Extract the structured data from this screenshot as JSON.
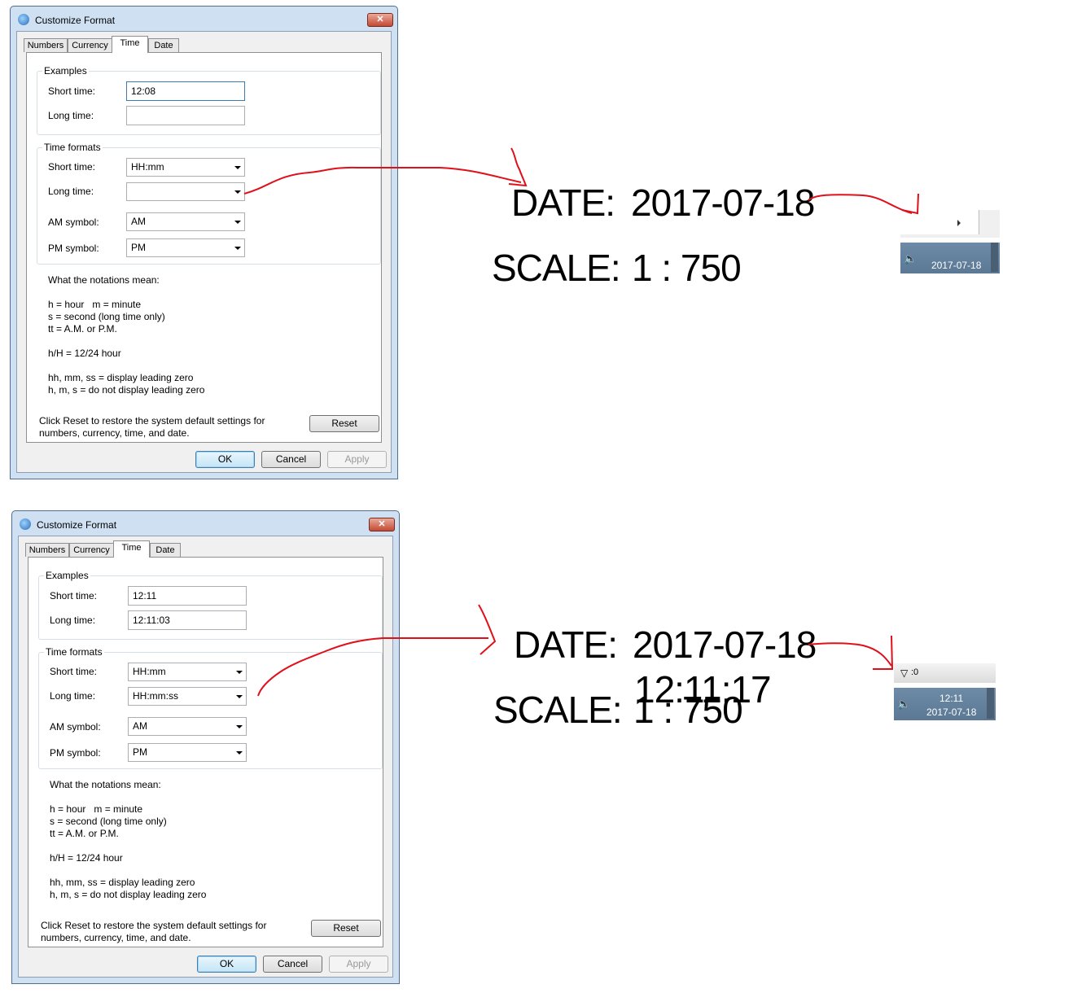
{
  "dialog": {
    "title": "Customize Format",
    "close_glyph": "✕",
    "tabs": [
      "Numbers",
      "Currency",
      "Time",
      "Date"
    ],
    "examples_heading": "Examples",
    "short_time_label": "Short time:",
    "long_time_label": "Long time:",
    "formats_heading": "Time formats",
    "am_label": "AM symbol:",
    "pm_label": "PM symbol:",
    "notations_heading": "What the notations mean:",
    "notation_line1": "h = hour   m = minute",
    "notation_line2": "s = second (long time only)",
    "notation_line3": "tt = A.M. or P.M.",
    "notation_line4": "h/H = 12/24 hour",
    "notation_line5": "hh, mm, ss = display leading zero",
    "notation_line6": "h, m, s = do not display leading zero",
    "reset_text_line1": "Click Reset to restore the system default settings for",
    "reset_text_line2": "numbers, currency, time, and date.",
    "reset_button": "Reset",
    "ok_button": "OK",
    "cancel_button": "Cancel",
    "apply_button": "Apply"
  },
  "top": {
    "example_short_time": "12:08",
    "example_long_time": "",
    "format_short_time": "HH:mm",
    "format_long_time": "",
    "am_symbol": "AM",
    "pm_symbol": "PM",
    "date_label": "DATE:",
    "date_value": "2017-07-18",
    "scale_label": "SCALE:",
    "scale_value": "1 : 750",
    "tray_date": "2017-07-18"
  },
  "bottom": {
    "example_short_time": "12:11",
    "example_long_time": "12:11:03",
    "format_short_time": "HH:mm",
    "format_long_time": "HH:mm:ss",
    "am_symbol": "AM",
    "pm_symbol": "PM",
    "date_label": "DATE:",
    "date_value": "2017-07-18",
    "time_value": "12:11:17",
    "scale_label": "SCALE:",
    "scale_value": "1 : 750",
    "filter_count": ":0",
    "tray_time": "12:11",
    "tray_date": "2017-07-18"
  },
  "colors": {
    "annotation_red": "#e0101a",
    "taskbar": "#5f7d99"
  }
}
